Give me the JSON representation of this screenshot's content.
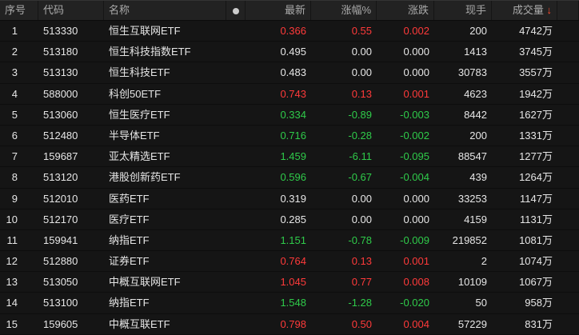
{
  "headers": {
    "idx": "序号",
    "code": "代码",
    "name": "名称",
    "last": "最新",
    "pct": "涨幅%",
    "chg": "涨跌",
    "hand": "现手",
    "vol": "成交量",
    "sort_icon": "↓"
  },
  "colors": {
    "up": "#ff3a3a",
    "down": "#2fcb4a",
    "flat": "#e6e6e6"
  },
  "rows": [
    {
      "idx": "1",
      "code": "513330",
      "name": "恒生互联网ETF",
      "last": "0.366",
      "pct": "0.55",
      "chg": "0.002",
      "hand": "200",
      "vol": "4742万",
      "dir": "up"
    },
    {
      "idx": "2",
      "code": "513180",
      "name": "恒生科技指数ETF",
      "last": "0.495",
      "pct": "0.00",
      "chg": "0.000",
      "hand": "1413",
      "vol": "3745万",
      "dir": "fl"
    },
    {
      "idx": "3",
      "code": "513130",
      "name": "恒生科技ETF",
      "last": "0.483",
      "pct": "0.00",
      "chg": "0.000",
      "hand": "30783",
      "vol": "3557万",
      "dir": "fl"
    },
    {
      "idx": "4",
      "code": "588000",
      "name": "科创50ETF",
      "last": "0.743",
      "pct": "0.13",
      "chg": "0.001",
      "hand": "4623",
      "vol": "1942万",
      "dir": "up"
    },
    {
      "idx": "5",
      "code": "513060",
      "name": "恒生医疗ETF",
      "last": "0.334",
      "pct": "-0.89",
      "chg": "-0.003",
      "hand": "8442",
      "vol": "1627万",
      "dir": "dn"
    },
    {
      "idx": "6",
      "code": "512480",
      "name": "半导体ETF",
      "last": "0.716",
      "pct": "-0.28",
      "chg": "-0.002",
      "hand": "200",
      "vol": "1331万",
      "dir": "dn"
    },
    {
      "idx": "7",
      "code": "159687",
      "name": "亚太精选ETF",
      "last": "1.459",
      "pct": "-6.11",
      "chg": "-0.095",
      "hand": "88547",
      "vol": "1277万",
      "dir": "dn"
    },
    {
      "idx": "8",
      "code": "513120",
      "name": "港股创新药ETF",
      "last": "0.596",
      "pct": "-0.67",
      "chg": "-0.004",
      "hand": "439",
      "vol": "1264万",
      "dir": "dn"
    },
    {
      "idx": "9",
      "code": "512010",
      "name": "医药ETF",
      "last": "0.319",
      "pct": "0.00",
      "chg": "0.000",
      "hand": "33253",
      "vol": "1147万",
      "dir": "fl"
    },
    {
      "idx": "10",
      "code": "512170",
      "name": "医疗ETF",
      "last": "0.285",
      "pct": "0.00",
      "chg": "0.000",
      "hand": "4159",
      "vol": "1131万",
      "dir": "fl"
    },
    {
      "idx": "11",
      "code": "159941",
      "name": "纳指ETF",
      "last": "1.151",
      "pct": "-0.78",
      "chg": "-0.009",
      "hand": "219852",
      "vol": "1081万",
      "dir": "dn"
    },
    {
      "idx": "12",
      "code": "512880",
      "name": "证券ETF",
      "last": "0.764",
      "pct": "0.13",
      "chg": "0.001",
      "hand": "2",
      "vol": "1074万",
      "dir": "up"
    },
    {
      "idx": "13",
      "code": "513050",
      "name": "中概互联网ETF",
      "last": "1.045",
      "pct": "0.77",
      "chg": "0.008",
      "hand": "10109",
      "vol": "1067万",
      "dir": "up"
    },
    {
      "idx": "14",
      "code": "513100",
      "name": "纳指ETF",
      "last": "1.548",
      "pct": "-1.28",
      "chg": "-0.020",
      "hand": "50",
      "vol": "958万",
      "dir": "dn"
    },
    {
      "idx": "15",
      "code": "159605",
      "name": "中概互联ETF",
      "last": "0.798",
      "pct": "0.50",
      "chg": "0.004",
      "hand": "57229",
      "vol": "831万",
      "dir": "up"
    }
  ]
}
